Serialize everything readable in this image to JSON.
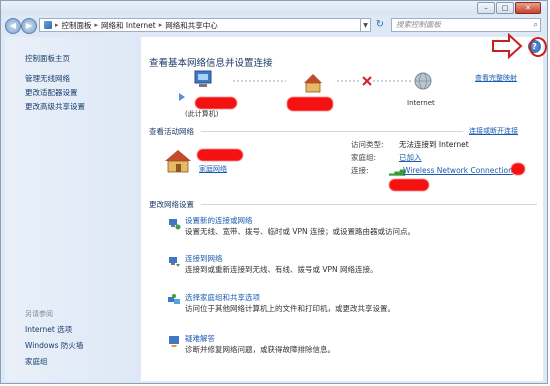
{
  "window": {
    "controls": {
      "minimize": "–",
      "maximize": "□",
      "close": "✕"
    }
  },
  "address_bar": {
    "back": "◀",
    "forward": "▶",
    "crumbs": [
      "控制面板",
      "网络和 Internet",
      "网络和共享中心"
    ],
    "refresh": "↻",
    "search_placeholder": "搜索控制面板"
  },
  "sidebar": {
    "home": "控制面板主页",
    "items": [
      "管理无线网络",
      "更改适配器设置",
      "更改高级共享设置"
    ],
    "see_also_label": "另请参阅",
    "see_also": [
      "Internet 选项",
      "Windows 防火墙",
      "家庭组"
    ]
  },
  "main": {
    "title": "查看基本网络信息并设置连接",
    "full_map_link": "查看完整映射",
    "map": {
      "computer_label": "(此计算机)",
      "internet_label": "Internet"
    },
    "active_networks": {
      "header": "查看活动网络",
      "connect_link": "连接或断开连接",
      "network_type": "家庭网络",
      "access_type_label": "访问类型:",
      "access_type_value": "无法连接到 Internet",
      "homegroup_label": "家庭组:",
      "homegroup_value": "已加入",
      "connection_label": "连接:",
      "connection_value": "Wireless Network Connection"
    },
    "change_settings": {
      "header": "更改网络设置",
      "tasks": [
        {
          "title": "设置新的连接或网络",
          "desc": "设置无线、宽带、拨号、临时或 VPN 连接；或设置路由器或访问点。"
        },
        {
          "title": "连接到网络",
          "desc": "连接到或重新连接到无线、有线、拨号或 VPN 网络连接。"
        },
        {
          "title": "选择家庭组和共享选项",
          "desc": "访问位于其他网络计算机上的文件和打印机，或更改共享设置。"
        },
        {
          "title": "疑难解答",
          "desc": "诊断并修复网络问题，或获得故障排除信息。"
        }
      ]
    },
    "help_icon": "?"
  },
  "colors": {
    "link": "#1a5bb0",
    "annotation_red": "#c8201e",
    "redaction": "#f41111"
  }
}
